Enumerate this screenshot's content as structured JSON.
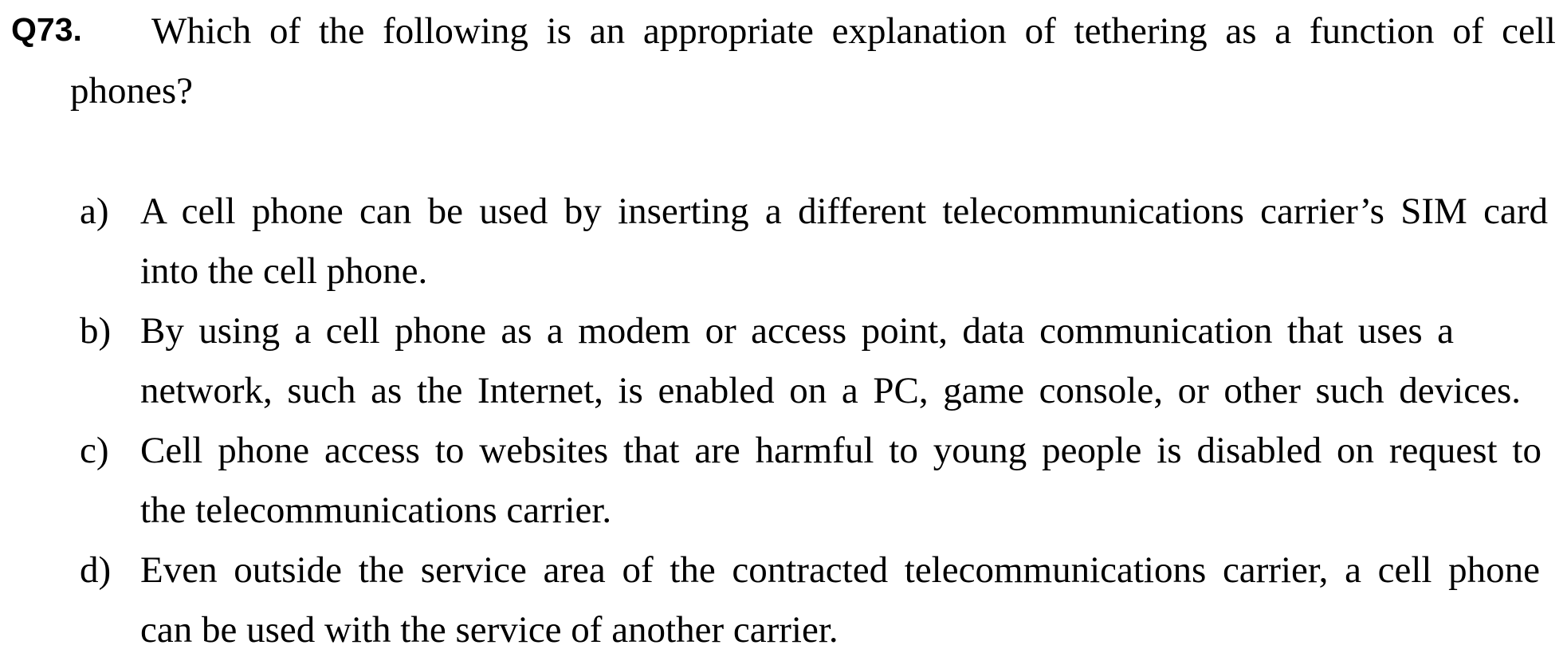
{
  "question": {
    "number": "Q73.",
    "lines": [
      "Which of the following is an appropriate explanation of tethering as a function of cell",
      "phones?"
    ]
  },
  "options": [
    {
      "label": "a)",
      "lines": [
        "A cell phone can be used by inserting a different telecommunications carrier’s SIM card",
        "into the cell phone."
      ]
    },
    {
      "label": "b)",
      "lines": [
        "By using a cell phone as a modem or access point, data communication that uses a",
        "network, such as the Internet, is enabled on a PC, game console, or other such devices."
      ]
    },
    {
      "label": "c)",
      "lines": [
        "Cell phone access to websites that are harmful to young people is disabled on request to",
        "the telecommunications carrier."
      ]
    },
    {
      "label": "d)",
      "lines": [
        "Even outside the service area of the contracted telecommunications carrier, a cell phone",
        "can be used with the service of another carrier."
      ]
    }
  ]
}
